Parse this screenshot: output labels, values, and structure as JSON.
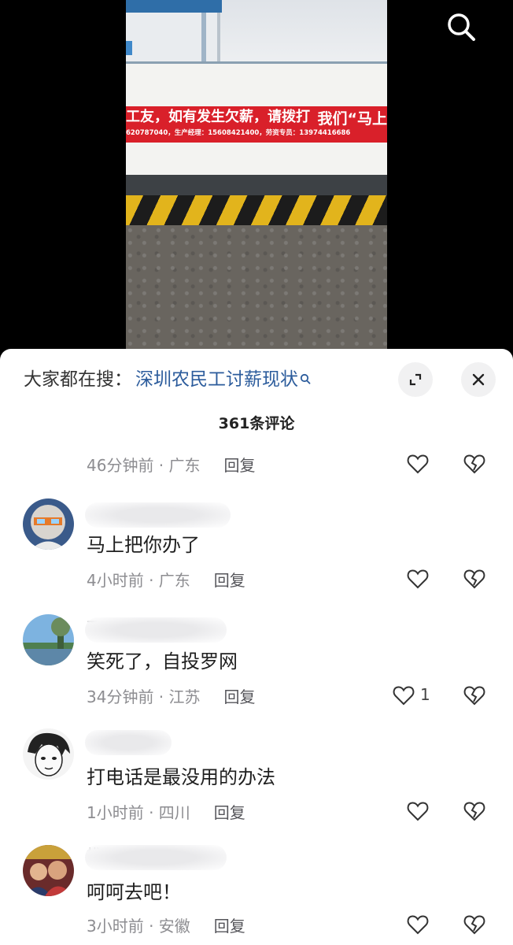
{
  "video": {
    "banner_main": "工友，如有发生欠薪，请拨打",
    "banner_right": "我们“马上",
    "banner_sub": "620787040，生产经理：15608421400，劳资专员：13974416686",
    "search_icon": "search-icon"
  },
  "panel": {
    "hot_search_prefix": "大家都在搜：",
    "hot_search_term": "深圳农民工讨薪现状",
    "hot_search_icon": "search-icon",
    "expand_icon": "expand-icon",
    "close_icon": "close-icon",
    "comment_count": "361条评论"
  },
  "comments": [
    {
      "text": "",
      "meta": "46分钟前 · 广东",
      "reply": "回复",
      "likes": ""
    },
    {
      "name_fragment": "",
      "text": "马上把你办了",
      "meta": "4小时前 · 广东",
      "reply": "回复",
      "likes": ""
    },
    {
      "name_fragment": "万里",
      "text": "笑死了，自投罗网",
      "meta": "34分钟前 · 江苏",
      "reply": "回复",
      "likes": "1"
    },
    {
      "name_fragment": "",
      "text": "打电话是最没用的办法",
      "meta": "1小时前 · 四川",
      "reply": "回复",
      "likes": ""
    },
    {
      "name_fragment": "拔",
      "text": "呵呵去吧！",
      "meta": "3小时前 · 安徽",
      "reply": "回复",
      "likes": ""
    }
  ],
  "icons": {
    "like": "heart-icon",
    "dislike": "broken-heart-icon"
  },
  "colors": {
    "link": "#2c5c9c",
    "banner": "#d9202a",
    "meta": "#8d8d91"
  }
}
